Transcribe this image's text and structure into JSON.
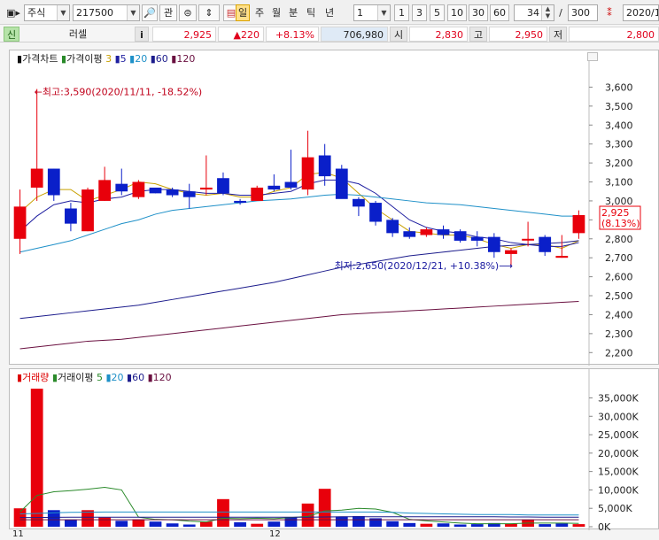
{
  "toolbar": {
    "market": "주식",
    "code": "217500",
    "btn_search": "🔎",
    "btn_interest": "관",
    "btn_link": "⊜",
    "btn_updown": "⇕",
    "periods": [
      "일",
      "주",
      "월",
      "분",
      "틱",
      "년"
    ],
    "interval_value": "1",
    "quick_intervals": [
      "1",
      "3",
      "5",
      "10",
      "30",
      "60"
    ],
    "count_current": "34",
    "count_sep": "/",
    "count_total": "300",
    "date": "2020/1"
  },
  "quote": {
    "new_badge": "신",
    "name": "러셀",
    "info_btn": "i",
    "price": "2,925",
    "change": "▲220",
    "change_pct": "+8.13%",
    "volume": "706,980",
    "open_label": "시",
    "open": "2,830",
    "high_label": "고",
    "high": "2,950",
    "low_label": "저",
    "low": "2,800"
  },
  "price_panel": {
    "legend": {
      "main": "가격차트",
      "ma_label": "가격이평",
      "ma_periods": [
        "3",
        "5",
        "20",
        "60",
        "120"
      ]
    },
    "max_annotation": "←최고:3,590(2020/11/11, -18.52%)",
    "min_annotation": "최저:2,650(2020/12/21, +10.38%)⟶",
    "current_price_label": "2,925",
    "current_pct_label": "(8.13%)",
    "colors": {
      "up": "#e8000b",
      "down": "#0a1fc9",
      "ma3": "#c8a000",
      "ma5": "#1f1fa0",
      "ma20": "#1e90c8",
      "ma60": "#1c1c8c",
      "ma120": "#6a1040"
    }
  },
  "volume_panel": {
    "legend": {
      "main": "거래량",
      "ma_label": "거래이평",
      "ma_periods": [
        "5",
        "20",
        "60",
        "120"
      ]
    }
  },
  "x_axis": {
    "labels": [
      "11",
      "12"
    ]
  },
  "chart_data": [
    {
      "type": "candlestick",
      "title": "가격차트",
      "ylim": [
        2150,
        3700
      ],
      "y_ticks": [
        "3,600",
        "3,500",
        "3,400",
        "3,300",
        "3,200",
        "3,100",
        "3,000",
        "2,900",
        "2,800",
        "2,700",
        "2,600",
        "2,500",
        "2,400",
        "2,300",
        "2,200"
      ],
      "candles": [
        {
          "o": 2800,
          "h": 3060,
          "l": 2720,
          "c": 2970
        },
        {
          "o": 3070,
          "h": 3590,
          "l": 3000,
          "c": 3170
        },
        {
          "o": 3170,
          "h": 3170,
          "l": 3000,
          "c": 3030
        },
        {
          "o": 2960,
          "h": 2990,
          "l": 2840,
          "c": 2880
        },
        {
          "o": 2840,
          "h": 3070,
          "l": 2840,
          "c": 3060
        },
        {
          "o": 3000,
          "h": 3180,
          "l": 3000,
          "c": 3110
        },
        {
          "o": 3090,
          "h": 3170,
          "l": 3030,
          "c": 3050
        },
        {
          "o": 3020,
          "h": 3110,
          "l": 3010,
          "c": 3100
        },
        {
          "o": 3070,
          "h": 3070,
          "l": 3040,
          "c": 3040
        },
        {
          "o": 3060,
          "h": 3070,
          "l": 3020,
          "c": 3030
        },
        {
          "o": 3050,
          "h": 3090,
          "l": 2960,
          "c": 3020
        },
        {
          "o": 3060,
          "h": 3240,
          "l": 3030,
          "c": 3070
        },
        {
          "o": 3120,
          "h": 3150,
          "l": 3030,
          "c": 3040
        },
        {
          "o": 3000,
          "h": 3010,
          "l": 2980,
          "c": 2990
        },
        {
          "o": 3000,
          "h": 3080,
          "l": 3000,
          "c": 3070
        },
        {
          "o": 3080,
          "h": 3140,
          "l": 3050,
          "c": 3060
        },
        {
          "o": 3100,
          "h": 3270,
          "l": 3060,
          "c": 3070
        },
        {
          "o": 3060,
          "h": 3370,
          "l": 3030,
          "c": 3230
        },
        {
          "o": 3240,
          "h": 3300,
          "l": 3080,
          "c": 3130
        },
        {
          "o": 3170,
          "h": 3190,
          "l": 3020,
          "c": 3010
        },
        {
          "o": 3010,
          "h": 3020,
          "l": 2920,
          "c": 2970
        },
        {
          "o": 2990,
          "h": 3000,
          "l": 2870,
          "c": 2890
        },
        {
          "o": 2900,
          "h": 2910,
          "l": 2810,
          "c": 2830
        },
        {
          "o": 2840,
          "h": 2860,
          "l": 2800,
          "c": 2810
        },
        {
          "o": 2820,
          "h": 2860,
          "l": 2810,
          "c": 2850
        },
        {
          "o": 2850,
          "h": 2870,
          "l": 2800,
          "c": 2820
        },
        {
          "o": 2840,
          "h": 2850,
          "l": 2780,
          "c": 2790
        },
        {
          "o": 2810,
          "h": 2840,
          "l": 2760,
          "c": 2790
        },
        {
          "o": 2810,
          "h": 2830,
          "l": 2700,
          "c": 2730
        },
        {
          "o": 2720,
          "h": 2750,
          "l": 2650,
          "c": 2740
        },
        {
          "o": 2800,
          "h": 2890,
          "l": 2760,
          "c": 2800
        },
        {
          "o": 2810,
          "h": 2820,
          "l": 2710,
          "c": 2730
        },
        {
          "o": 2700,
          "h": 2820,
          "l": 2700,
          "c": 2710
        },
        {
          "o": 2830,
          "h": 2950,
          "l": 2800,
          "c": 2925
        }
      ],
      "ma_series": [
        {
          "name": "3",
          "values": [
            2940,
            3020,
            3060,
            3060,
            3000,
            3030,
            3060,
            3100,
            3090,
            3060,
            3040,
            3030,
            3040,
            3020,
            3020,
            3050,
            3070,
            3140,
            3150,
            3120,
            3040,
            2960,
            2900,
            2840,
            2830,
            2820,
            2820,
            2800,
            2770,
            2750,
            2770,
            2770,
            2750,
            2790
          ]
        },
        {
          "name": "5",
          "values": [
            2840,
            2920,
            2980,
            3000,
            2990,
            3010,
            3020,
            3050,
            3060,
            3060,
            3050,
            3040,
            3040,
            3030,
            3030,
            3040,
            3050,
            3090,
            3110,
            3110,
            3090,
            3040,
            2970,
            2900,
            2860,
            2840,
            2830,
            2810,
            2800,
            2780,
            2770,
            2760,
            2760,
            2780
          ]
        },
        {
          "name": "20",
          "values": [
            2730,
            2750,
            2770,
            2790,
            2820,
            2850,
            2880,
            2900,
            2930,
            2950,
            2960,
            2970,
            2980,
            2990,
            3000,
            3005,
            3010,
            3020,
            3030,
            3035,
            3030,
            3020,
            3010,
            3000,
            2990,
            2985,
            2980,
            2970,
            2960,
            2950,
            2940,
            2930,
            2920,
            2920
          ]
        },
        {
          "name": "60",
          "values": [
            2380,
            2390,
            2400,
            2410,
            2420,
            2430,
            2440,
            2450,
            2465,
            2480,
            2495,
            2510,
            2525,
            2540,
            2555,
            2570,
            2590,
            2610,
            2630,
            2650,
            2665,
            2680,
            2695,
            2710,
            2720,
            2730,
            2740,
            2750,
            2760,
            2765,
            2770,
            2775,
            2780,
            2790
          ]
        },
        {
          "name": "120",
          "values": [
            2220,
            2230,
            2240,
            2250,
            2260,
            2265,
            2270,
            2280,
            2290,
            2300,
            2310,
            2320,
            2330,
            2340,
            2350,
            2360,
            2370,
            2380,
            2390,
            2400,
            2405,
            2410,
            2415,
            2420,
            2425,
            2430,
            2435,
            2440,
            2445,
            2450,
            2455,
            2460,
            2465,
            2470
          ]
        }
      ]
    },
    {
      "type": "bar",
      "title": "거래량",
      "ylim": [
        0,
        38000
      ],
      "y_ticks": [
        "35,000K",
        "30,000K",
        "25,000K",
        "20,000K",
        "15,000K",
        "10,000K",
        "5,000K",
        "0K"
      ],
      "unit": "K",
      "values": [
        5000,
        37500,
        4500,
        1800,
        4500,
        2500,
        1600,
        2000,
        1400,
        900,
        600,
        1400,
        7500,
        1200,
        800,
        1400,
        2600,
        6300,
        10300,
        2800,
        2900,
        2300,
        1500,
        1000,
        800,
        900,
        600,
        700,
        1000,
        800,
        1800,
        700,
        900,
        700
      ],
      "up": [
        true,
        true,
        false,
        false,
        true,
        true,
        false,
        true,
        false,
        false,
        false,
        true,
        true,
        false,
        true,
        false,
        false,
        true,
        true,
        false,
        false,
        false,
        false,
        false,
        true,
        false,
        false,
        false,
        false,
        true,
        true,
        false,
        false,
        true
      ],
      "ma_series": [
        {
          "name": "5",
          "values": [
            4000,
            8500,
            9500,
            9800,
            10200,
            10700,
            10000,
            2600,
            2000,
            1900,
            1500,
            1300,
            2300,
            2200,
            2300,
            2200,
            2500,
            2800,
            4300,
            4500,
            5000,
            4800,
            3900,
            2000,
            1600,
            1300,
            1000,
            800,
            800,
            800,
            1000,
            1000,
            1000,
            900
          ]
        },
        {
          "name": "20",
          "values": [
            3500,
            3600,
            3800,
            3900,
            3950,
            4000,
            4000,
            4000,
            4000,
            4000,
            4000,
            4000,
            4000,
            4000,
            4000,
            4000,
            4000,
            4000,
            4000,
            4000,
            4000,
            4000,
            3900,
            3700,
            3600,
            3500,
            3400,
            3300,
            3300,
            3300,
            3200,
            3200,
            3200,
            3200
          ]
        },
        {
          "name": "60",
          "values": [
            2500,
            2500,
            2550,
            2600,
            2600,
            2600,
            2600,
            2600,
            2600,
            2600,
            2600,
            2600,
            2600,
            2600,
            2600,
            2600,
            2600,
            2600,
            2650,
            2700,
            2700,
            2700,
            2700,
            2700,
            2700,
            2700,
            2700,
            2700,
            2700,
            2650,
            2650,
            2600,
            2600,
            2600
          ]
        },
        {
          "name": "120",
          "values": [
            1900,
            1900,
            1900,
            1900,
            1900,
            1900,
            1900,
            1900,
            1900,
            1900,
            1900,
            1900,
            1900,
            1900,
            1900,
            1900,
            1900,
            1900,
            1900,
            1900,
            1900,
            1900,
            1900,
            1900,
            1900,
            1900,
            1900,
            1900,
            1900,
            1900,
            1900,
            1900,
            1900,
            1900
          ]
        }
      ]
    }
  ]
}
